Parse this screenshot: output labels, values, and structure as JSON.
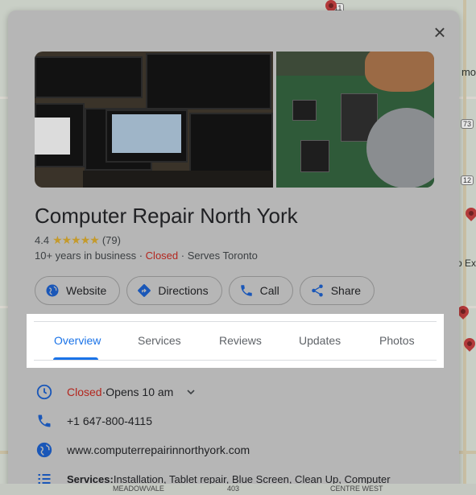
{
  "map": {
    "edge_labels": [
      "mo",
      "p Ex"
    ],
    "shields": [
      "11",
      "73",
      "12"
    ],
    "bottom_labels": [
      "MEADOWVALE",
      "403",
      "CENTRE WEST"
    ]
  },
  "panel": {
    "close_label": "×",
    "business": {
      "name": "Computer Repair North York",
      "rating": "4.4",
      "stars": "★★★★★",
      "review_count": "(79)",
      "years": "10+ years in business",
      "sep": " · ",
      "status": "Closed",
      "serves": "Serves Toronto"
    },
    "actions": [
      {
        "label": "Website",
        "icon": "globe-icon"
      },
      {
        "label": "Directions",
        "icon": "directions-icon"
      },
      {
        "label": "Call",
        "icon": "phone-icon"
      },
      {
        "label": "Share",
        "icon": "share-icon"
      }
    ],
    "tabs": [
      "Overview",
      "Services",
      "Reviews",
      "Updates",
      "Photos"
    ],
    "active_tab": "Overview",
    "details": {
      "hours_status": "Closed",
      "hours_sep": " · ",
      "hours_next": "Opens 10 am",
      "phone": "+1 647-800-4115",
      "website": "www.computerrepairinnorthyork.com",
      "services_label": "Services:",
      "services_text": " Installation, Tablet repair, Blue Screen, Clean Up, Computer"
    },
    "colors": {
      "accent": "#1a73e8",
      "closed": "#b3261e",
      "star": "#c49a2c"
    }
  }
}
